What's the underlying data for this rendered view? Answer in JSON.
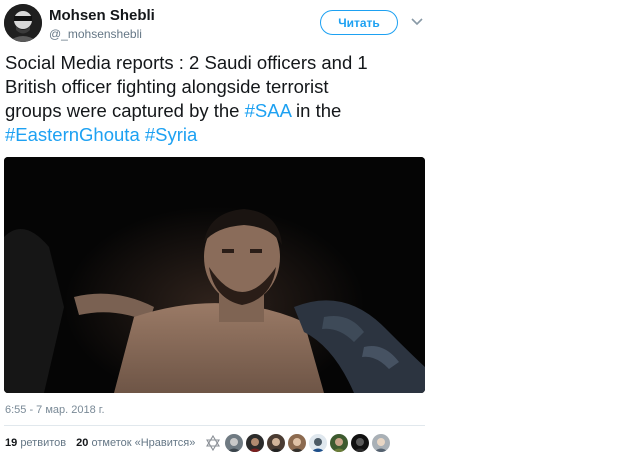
{
  "author": {
    "name": "Mohsen Shebli",
    "handle": "@_mohsenshebli"
  },
  "actions": {
    "follow_label": "Читать"
  },
  "tweet": {
    "line1": "Social Media reports : 2 Saudi officers and 1",
    "line2": "British officer fighting alongside terrorist",
    "line3_text": "groups were captured by the ",
    "line3_hashtag": "#SAA",
    "line3_tail": " in the",
    "hashtag_ghouta": "#EasternGhouta",
    "hashtag_syria": "#Syria"
  },
  "timestamp": "6:55 - 7 мар. 2018 г.",
  "stats": {
    "retweets_count": "19",
    "retweets_label": "ретвитов",
    "likes_count": "20",
    "likes_label": "отметок «Нравится»"
  },
  "icons": {
    "menu": "chevron-down-icon",
    "liker_first": "star-of-david-icon"
  },
  "colors": {
    "accent": "#1da1f2",
    "text": "#14171a",
    "muted": "#657786"
  }
}
